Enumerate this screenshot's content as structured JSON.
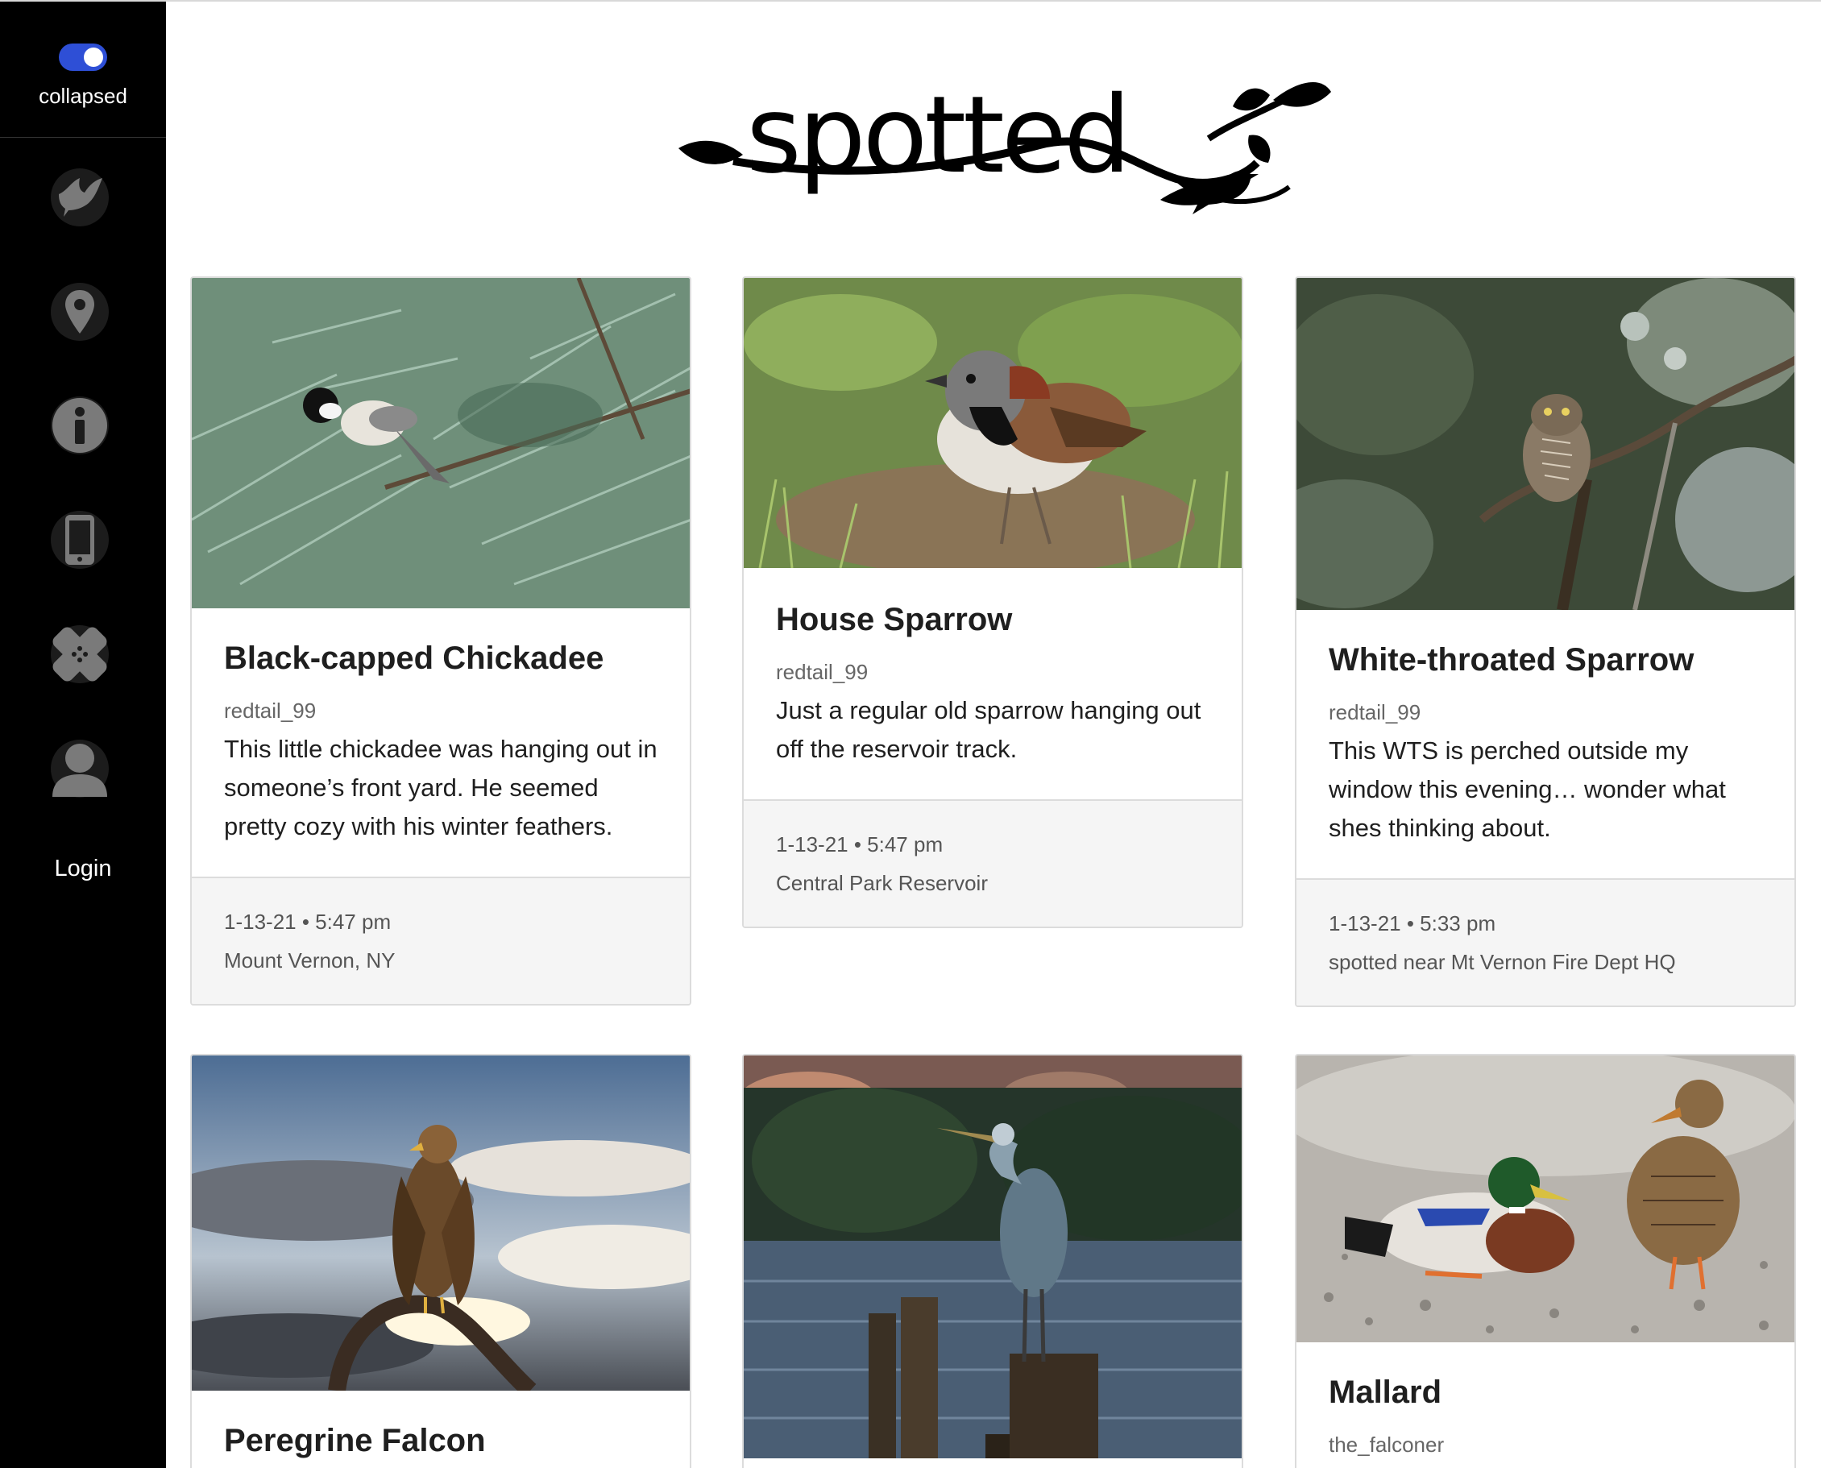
{
  "sidebar": {
    "toggle_label": "collapsed",
    "toggle_on": true,
    "accent_color": "#2e4fd6",
    "icons": [
      "bird-icon",
      "location-pin-icon",
      "info-icon",
      "phone-icon",
      "bandage-icon",
      "user-icon"
    ],
    "login_label": "Login"
  },
  "brand": {
    "logo_text": "spotted"
  },
  "cards": [
    {
      "title": "Black-capped Chickadee",
      "user": "redtail_99",
      "text": "This little chickadee was hanging out in someone’s front yard. He seemed pretty cozy with his winter feathers.",
      "time": "1-13-21 • 5:47 pm",
      "location": "Mount Vernon, NY",
      "image": "chickadee-in-pine-photo"
    },
    {
      "title": "House Sparrow",
      "user": "redtail_99",
      "text": "Just a regular old sparrow hanging out off the reservoir track.",
      "time": "1-13-21 • 5:47 pm",
      "location": "Central Park Reservoir",
      "image": "sparrow-on-grass-photo"
    },
    {
      "title": "White-throated Sparrow",
      "user": "redtail_99",
      "text": "This WTS is perched outside my window this evening… wonder what shes thinking about.",
      "time": "1-13-21 • 5:33 pm",
      "location": "spotted near Mt Vernon Fire Dept HQ",
      "image": "owl-on-branch-photo"
    },
    {
      "title": "Peregrine Falcon",
      "image": "eagle-on-branch-photo"
    },
    {
      "image": "heron-on-post-photo"
    },
    {
      "title": "Mallard",
      "user": "the_falconer",
      "image": "ducks-on-gravel-photo"
    }
  ]
}
